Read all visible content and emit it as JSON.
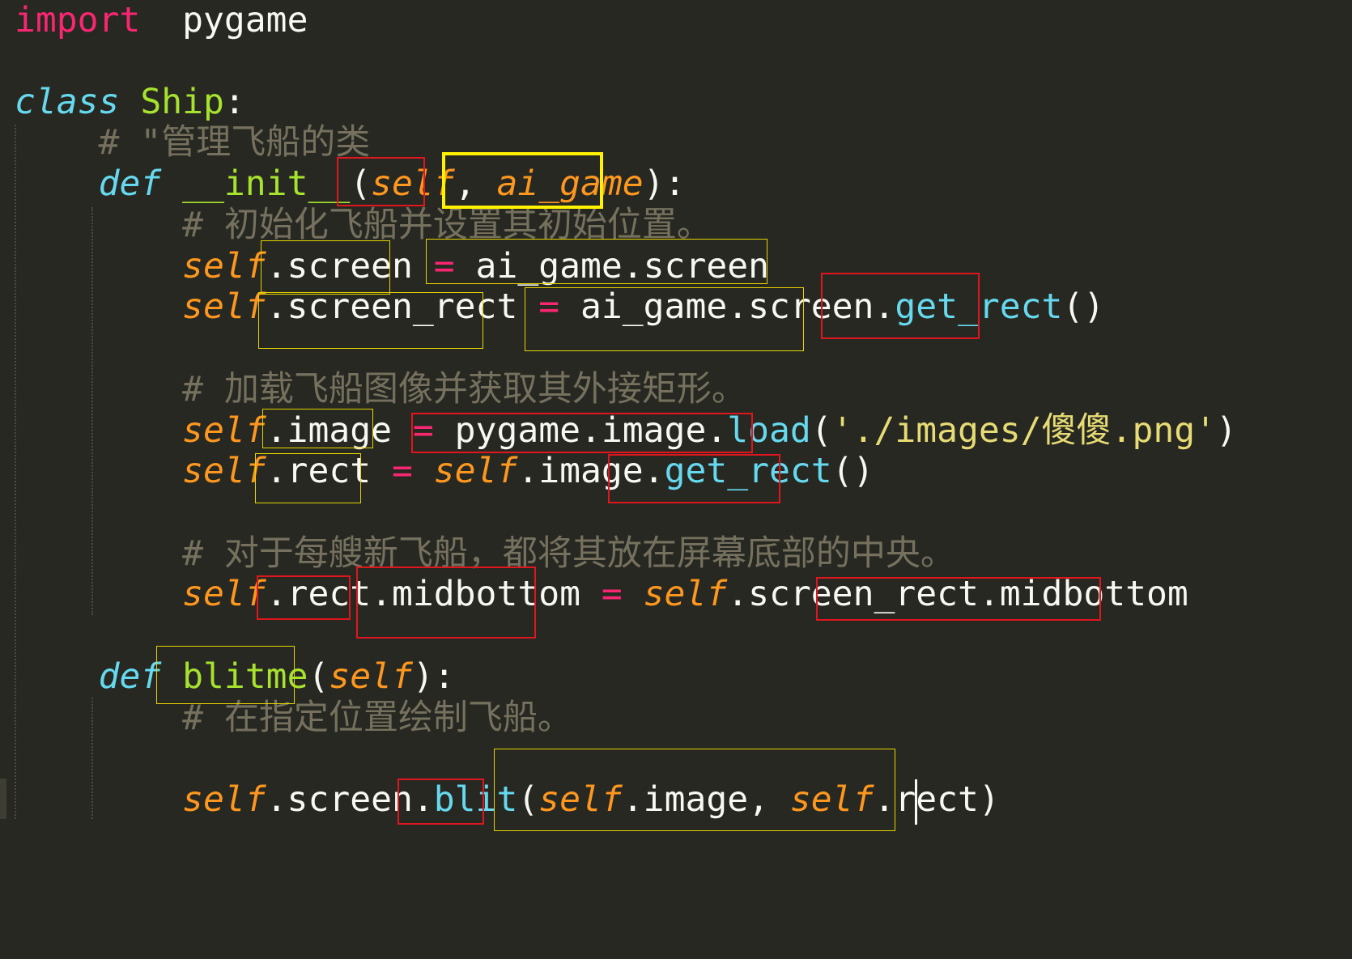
{
  "editor": {
    "lines": [
      {
        "id": "l1",
        "tokens": [
          {
            "t": "import",
            "c": "kw-import"
          },
          {
            "t": "  ",
            "c": "plain"
          },
          {
            "t": "pygame",
            "c": "plain"
          }
        ]
      },
      {
        "id": "l3",
        "tokens": [
          {
            "t": "class",
            "c": "kw-class"
          },
          {
            "t": " ",
            "c": "plain"
          },
          {
            "t": "Ship",
            "c": "cls-name"
          },
          {
            "t": ":",
            "c": "plain"
          }
        ]
      },
      {
        "id": "l4",
        "tokens": [
          {
            "t": "    # \"管理飞船的类",
            "c": "comment"
          }
        ]
      },
      {
        "id": "l5",
        "tokens": [
          {
            "t": "    ",
            "c": "plain"
          },
          {
            "t": "def",
            "c": "kw-def"
          },
          {
            "t": " ",
            "c": "plain"
          },
          {
            "t": "__init__",
            "c": "fn-name"
          },
          {
            "t": "(",
            "c": "plain"
          },
          {
            "t": "self",
            "c": "param"
          },
          {
            "t": ", ",
            "c": "plain"
          },
          {
            "t": "ai_game",
            "c": "param"
          },
          {
            "t": "):",
            "c": "plain"
          }
        ]
      },
      {
        "id": "l6",
        "tokens": [
          {
            "t": "        # 初始化飞船并设置其初始位置。",
            "c": "comment"
          }
        ]
      },
      {
        "id": "l7",
        "tokens": [
          {
            "t": "        ",
            "c": "plain"
          },
          {
            "t": "self",
            "c": "self"
          },
          {
            "t": ".screen ",
            "c": "plain"
          },
          {
            "t": "=",
            "c": "op"
          },
          {
            "t": " ai_game.screen",
            "c": "plain"
          }
        ]
      },
      {
        "id": "l8",
        "tokens": [
          {
            "t": "        ",
            "c": "plain"
          },
          {
            "t": "self",
            "c": "self"
          },
          {
            "t": ".screen_rect ",
            "c": "plain"
          },
          {
            "t": "=",
            "c": "op"
          },
          {
            "t": " ai_game.screen.",
            "c": "plain"
          },
          {
            "t": "get_rect",
            "c": "call"
          },
          {
            "t": "()",
            "c": "plain"
          }
        ]
      },
      {
        "id": "l10",
        "tokens": [
          {
            "t": "        # 加载飞船图像并获取其外接矩形。",
            "c": "comment"
          }
        ]
      },
      {
        "id": "l11",
        "tokens": [
          {
            "t": "        ",
            "c": "plain"
          },
          {
            "t": "self",
            "c": "self"
          },
          {
            "t": ".image ",
            "c": "plain"
          },
          {
            "t": "=",
            "c": "op"
          },
          {
            "t": " pygame.image.",
            "c": "plain"
          },
          {
            "t": "load",
            "c": "call"
          },
          {
            "t": "(",
            "c": "plain"
          },
          {
            "t": "'./images/傻傻.png'",
            "c": "str"
          },
          {
            "t": ")",
            "c": "plain"
          }
        ]
      },
      {
        "id": "l12",
        "tokens": [
          {
            "t": "        ",
            "c": "plain"
          },
          {
            "t": "self",
            "c": "self"
          },
          {
            "t": ".rect ",
            "c": "plain"
          },
          {
            "t": "=",
            "c": "op"
          },
          {
            "t": " ",
            "c": "plain"
          },
          {
            "t": "self",
            "c": "self"
          },
          {
            "t": ".image.",
            "c": "plain"
          },
          {
            "t": "get_rect",
            "c": "call"
          },
          {
            "t": "()",
            "c": "plain"
          }
        ]
      },
      {
        "id": "l14",
        "tokens": [
          {
            "t": "        # 对于每艘新飞船，都将其放在屏幕底部的中央。",
            "c": "comment"
          }
        ]
      },
      {
        "id": "l15",
        "tokens": [
          {
            "t": "        ",
            "c": "plain"
          },
          {
            "t": "self",
            "c": "self"
          },
          {
            "t": ".rect.midbottom ",
            "c": "plain"
          },
          {
            "t": "=",
            "c": "op"
          },
          {
            "t": " ",
            "c": "plain"
          },
          {
            "t": "self",
            "c": "self"
          },
          {
            "t": ".screen_rect.midbottom",
            "c": "plain"
          }
        ]
      },
      {
        "id": "l17",
        "tokens": [
          {
            "t": "    ",
            "c": "plain"
          },
          {
            "t": "def",
            "c": "kw-def"
          },
          {
            "t": " ",
            "c": "plain"
          },
          {
            "t": "blitme",
            "c": "fn-name"
          },
          {
            "t": "(",
            "c": "plain"
          },
          {
            "t": "self",
            "c": "param"
          },
          {
            "t": "):",
            "c": "plain"
          }
        ]
      },
      {
        "id": "l18",
        "tokens": [
          {
            "t": "        # 在指定位置绘制飞船。",
            "c": "comment"
          }
        ]
      },
      {
        "id": "l20",
        "tokens": [
          {
            "t": "        ",
            "c": "plain"
          },
          {
            "t": "self",
            "c": "self"
          },
          {
            "t": ".screen.",
            "c": "plain"
          },
          {
            "t": "blit",
            "c": "call"
          },
          {
            "t": "(",
            "c": "plain"
          },
          {
            "t": "self",
            "c": "self"
          },
          {
            "t": ".image, ",
            "c": "plain"
          },
          {
            "t": "self",
            "c": "self"
          },
          {
            "t": ".rect)",
            "c": "plain"
          }
        ]
      }
    ]
  }
}
